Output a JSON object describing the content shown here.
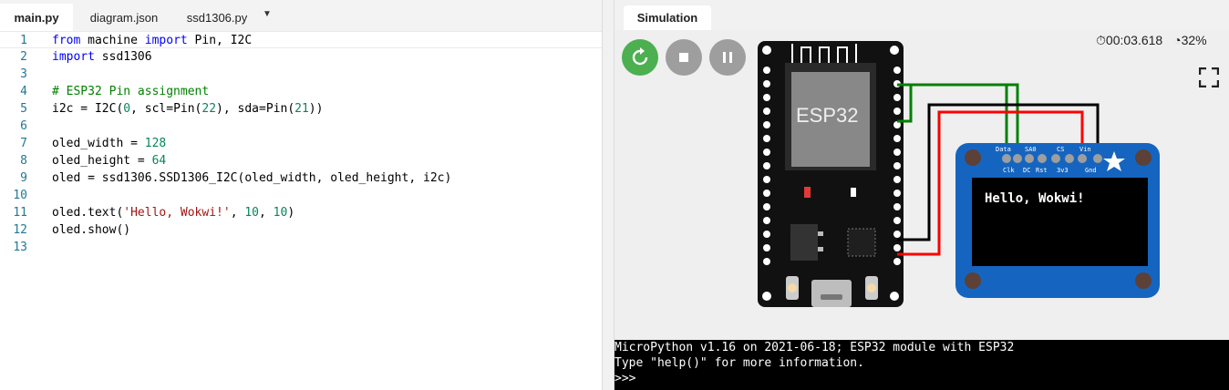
{
  "editor": {
    "tabs": [
      "main.py",
      "diagram.json",
      "ssd1306.py"
    ],
    "tab_menu_icon": "caret-down-icon",
    "line_numbers": [
      "1",
      "2",
      "3",
      "4",
      "5",
      "6",
      "7",
      "8",
      "9",
      "10",
      "11",
      "12",
      "13"
    ]
  },
  "simulation": {
    "tab_label": "Simulation",
    "timer": "00:03.618",
    "cpu": "32%",
    "board_label": "ESP32",
    "display_text": "Hello, Wokwi!",
    "colors": {
      "run": "#4caf50",
      "wire_green": "#008000",
      "wire_red": "#ff0000",
      "wire_black": "#000000",
      "oled_board": "#1565c0"
    },
    "oled_pins_top": [
      "Data",
      "SA0",
      "CS",
      "Vin"
    ],
    "oled_pins_bottom": [
      "Clk",
      "DC",
      "Rst",
      "3v3",
      "Gnd"
    ]
  },
  "serial": {
    "lines": [
      "MicroPython v1.16 on 2021-06-18; ESP32 module with ESP32",
      "Type \"help()\" for more information.",
      ">>>"
    ]
  }
}
